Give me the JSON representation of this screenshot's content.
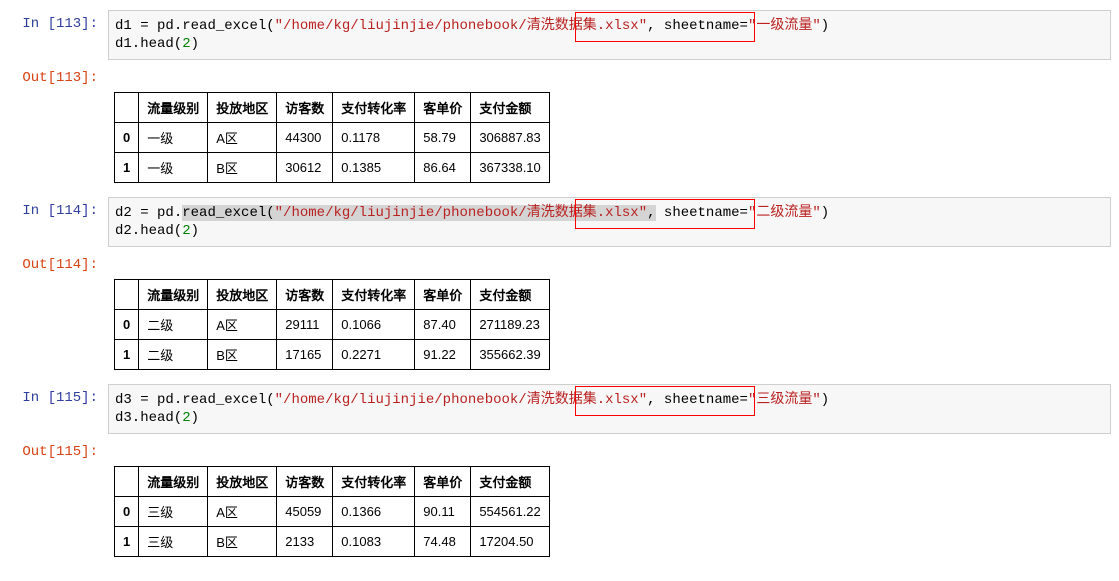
{
  "cells": [
    {
      "in_prompt": "In  [113]:",
      "out_prompt": "Out[113]:",
      "code_var": "d1",
      "code_prefix_plain": " = pd.",
      "code_read": "read_excel(",
      "code_path": "\"/home/kg/liujinjie/phonebook/清洗数据集.xlsx\"",
      "code_comma": ",",
      "code_sheet_key": " sheetname=",
      "code_sheet_val": "\"一级流量\"",
      "code_close": ")",
      "code_line2_a": "d1.head(",
      "code_line2_n": "2",
      "code_line2_b": ")",
      "headers": [
        "",
        "流量级别",
        "投放地区",
        "访客数",
        "支付转化率",
        "客单价",
        "支付金额"
      ],
      "rows": [
        [
          "0",
          "一级",
          "A区",
          "44300",
          "0.1178",
          "58.79",
          "306887.83"
        ],
        [
          "1",
          "一级",
          "B区",
          "30612",
          "0.1385",
          "86.64",
          "367338.10"
        ]
      ]
    },
    {
      "in_prompt": "In  [114]:",
      "out_prompt": "Out[114]:",
      "code_var": "d2",
      "code_prefix_plain": " = pd.",
      "code_read": "read_excel(",
      "code_path": "\"/home/kg/liujinjie/phonebook/清洗数据集.xlsx\"",
      "code_comma": ",",
      "code_sheet_key": " sheetname=",
      "code_sheet_val": "\"二级流量\"",
      "code_close": ")",
      "code_line2_a": "d2.head(",
      "code_line2_n": "2",
      "code_line2_b": ")",
      "headers": [
        "",
        "流量级别",
        "投放地区",
        "访客数",
        "支付转化率",
        "客单价",
        "支付金额"
      ],
      "rows": [
        [
          "0",
          "二级",
          "A区",
          "29111",
          "0.1066",
          "87.40",
          "271189.23"
        ],
        [
          "1",
          "二级",
          "B区",
          "17165",
          "0.2271",
          "91.22",
          "355662.39"
        ]
      ]
    },
    {
      "in_prompt": "In  [115]:",
      "out_prompt": "Out[115]:",
      "code_var": "d3",
      "code_prefix_plain": " = pd.",
      "code_read": "read_excel(",
      "code_path": "\"/home/kg/liujinjie/phonebook/清洗数据集.xlsx\"",
      "code_comma": ",",
      "code_sheet_key": " sheetname=",
      "code_sheet_val": "\"三级流量\"",
      "code_close": ")",
      "code_line2_a": "d3.head(",
      "code_line2_n": "2",
      "code_line2_b": ")",
      "headers": [
        "",
        "流量级别",
        "投放地区",
        "访客数",
        "支付转化率",
        "客单价",
        "支付金额"
      ],
      "rows": [
        [
          "0",
          "三级",
          "A区",
          "45059",
          "0.1366",
          "90.11",
          "554561.22"
        ],
        [
          "1",
          "三级",
          "B区",
          "2133",
          "0.1083",
          "74.48",
          "17204.50"
        ]
      ]
    }
  ]
}
